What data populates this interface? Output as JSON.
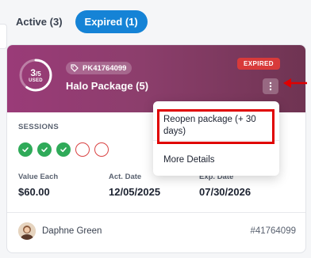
{
  "tabs": [
    {
      "label": "Active (3)",
      "selected": false
    },
    {
      "label": "Expired (1)",
      "selected": true
    }
  ],
  "package": {
    "id": "PK41764099",
    "name": "Halo Package (5)",
    "status": "EXPIRED",
    "used": "3",
    "total": "/5",
    "used_label": "USED",
    "used_fraction": 0.6
  },
  "sessions": {
    "label": "SESSIONS",
    "states": [
      "done",
      "done",
      "done",
      "open",
      "open"
    ]
  },
  "stats": [
    {
      "label": "Value Each",
      "value": "$60.00"
    },
    {
      "label": "Act. Date",
      "value": "12/05/2025"
    },
    {
      "label": "Exp. Date",
      "value": "07/30/2026"
    }
  ],
  "footer": {
    "owner": "Daphne Green",
    "ref": "#41764099"
  },
  "menu": {
    "items": [
      "Reopen package (+ 30 days)",
      "More Details"
    ]
  },
  "colors": {
    "accent": "#1583d6",
    "banner": "#8c3e6c",
    "expired": "#d83a3a",
    "done": "#2faa59",
    "annotation": "#e00000"
  }
}
